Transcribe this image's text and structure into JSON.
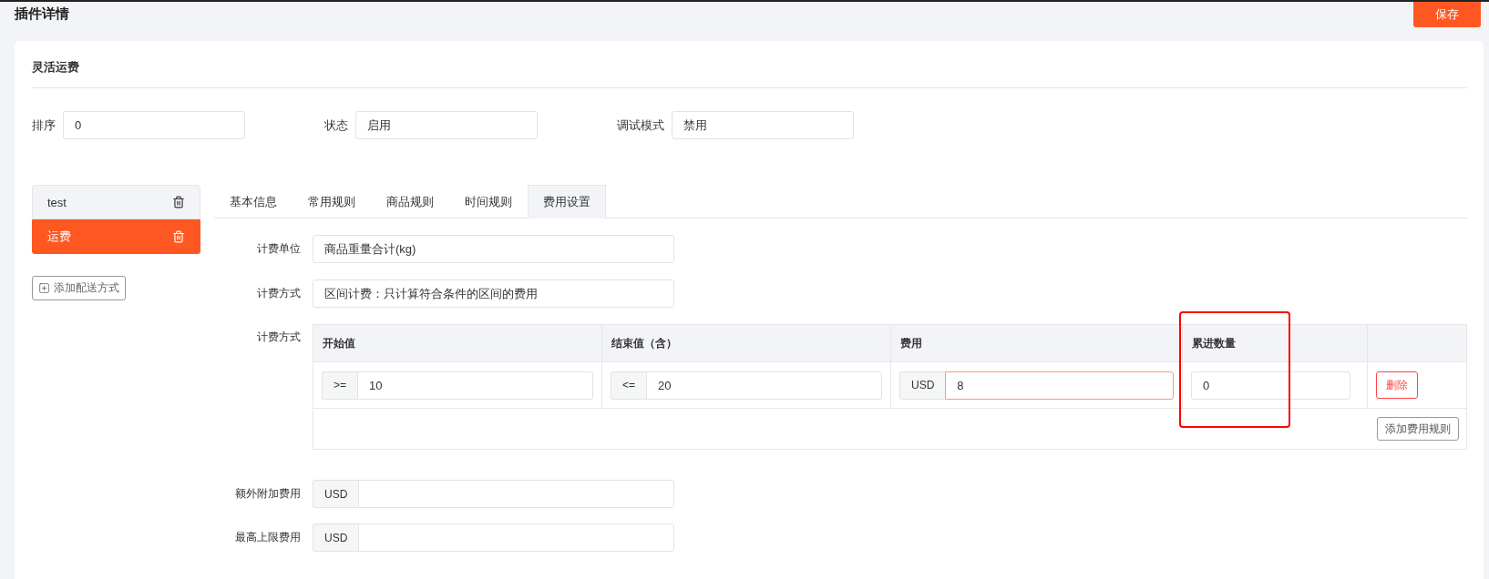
{
  "page": {
    "title": "插件详情",
    "save_button": "保存"
  },
  "card": {
    "title": "灵活运费"
  },
  "settings": [
    {
      "label": "排序",
      "value": "0"
    },
    {
      "label": "状态",
      "value": "启用"
    },
    {
      "label": "调试模式",
      "value": "禁用"
    }
  ],
  "methods": [
    {
      "name": "test",
      "selected": false
    },
    {
      "name": "运费",
      "selected": true
    }
  ],
  "add_method_button": "添加配送方式",
  "tabs": [
    {
      "label": "基本信息",
      "selected": false
    },
    {
      "label": "常用规则",
      "selected": false
    },
    {
      "label": "商品规则",
      "selected": false
    },
    {
      "label": "时间规则",
      "selected": false
    },
    {
      "label": "费用设置",
      "selected": true
    }
  ],
  "fields": [
    {
      "label": "计费单位",
      "value": "商品重量合计(kg)"
    },
    {
      "label": "计费方式",
      "value": "区间计费：只计算符合条件的区间的费用"
    }
  ],
  "rules": {
    "label": "计费方式",
    "columns": [
      {
        "title": "开始值",
        "highlighted": false
      },
      {
        "title": "结束值（含）",
        "highlighted": false
      },
      {
        "title": "费用",
        "highlighted": false
      },
      {
        "title": "累进数量",
        "highlighted": true
      }
    ],
    "rows": [
      {
        "cells": [
          {
            "kind": "addon",
            "prefix": ">=",
            "value": "10",
            "focused": false
          },
          {
            "kind": "addon",
            "prefix": "<=",
            "value": "20",
            "focused": false
          },
          {
            "kind": "addon",
            "prefix": "USD",
            "value": "8",
            "focused": true
          },
          {
            "kind": "plain",
            "value": "0",
            "focused": false
          }
        ],
        "delete_button": "删除"
      }
    ],
    "add_button": "添加费用规则"
  },
  "extra_fees": [
    {
      "label": "额外附加费用",
      "prefix": "USD"
    },
    {
      "label": "最高上限费用",
      "prefix": "USD"
    }
  ]
}
